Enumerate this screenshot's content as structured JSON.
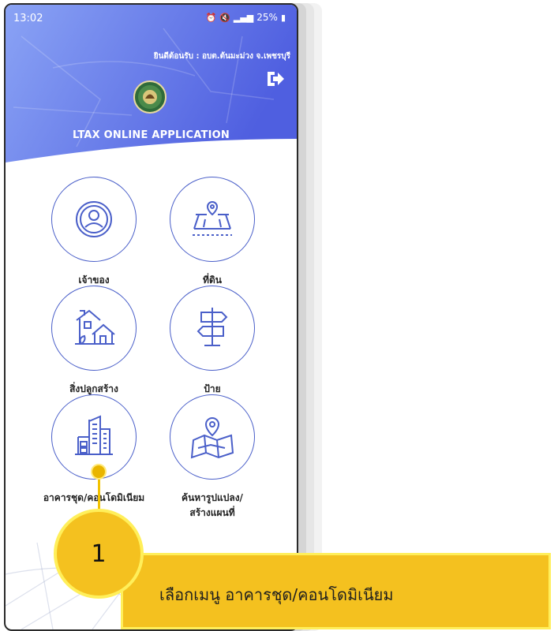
{
  "status_bar": {
    "time": "13:02",
    "battery": "25%"
  },
  "header": {
    "welcome_text": "ยินดีต้อนรับ : อบต.ต้นมะม่วง จ.เพชรบุรี",
    "app_title": "LTAX ONLINE APPLICATION"
  },
  "menu": {
    "items": [
      {
        "label": "เจ้าของ",
        "icon": "owner-icon"
      },
      {
        "label": "ที่ดิน",
        "icon": "land-icon"
      },
      {
        "label": "สิ่งปลูกสร้าง",
        "icon": "building-house-icon"
      },
      {
        "label": "ป้าย",
        "icon": "signpost-icon"
      },
      {
        "label": "อาคารชุด/คอนโดมิเนียม",
        "icon": "condominium-icon"
      },
      {
        "label_line1": "ค้นหารูปแปลง/",
        "label_line2": "สร้างแผนที่",
        "icon": "map-search-icon"
      }
    ]
  },
  "callout": {
    "step_number": "1",
    "text": "เลือกเมนู อาคารชุด/คอนโดมิเนียม"
  },
  "colors": {
    "header_gradient_left": "#8aa3f5",
    "header_gradient_right": "#4f5fe0",
    "icon_stroke": "#4a5fc9",
    "callout_fill": "#f4c11f",
    "callout_border": "#ffef5a"
  }
}
